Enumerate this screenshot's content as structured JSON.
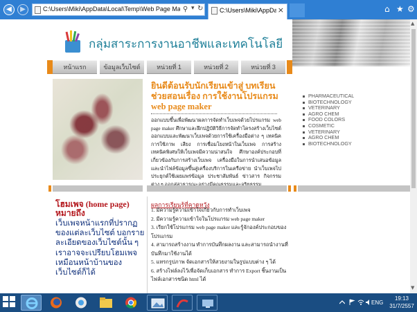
{
  "browser": {
    "address": "C:\\Users\\Miki\\AppData\\Local\\Temp\\Web Page Maker\\Preview\\sen",
    "tab_title": "C:\\Users\\Miki\\AppData\\Lo...",
    "tab_close": "×",
    "icons": [
      "back-icon",
      "forward-icon",
      "search-icon",
      "refresh-icon",
      "home-icon",
      "favorites-icon",
      "tools-icon"
    ]
  },
  "site": {
    "title": "กลุ่มสาระการงานอาชีพและเทคโนโลยี",
    "accent_color": "#e88a1a",
    "title_color": "#1e7f98"
  },
  "nav": {
    "items": [
      "หน้าแรก",
      "ข้อมูลเว็บไซต์",
      "หน่วยที่ 1",
      "หน่วยที่ 2",
      "หน่วยที่ 3"
    ]
  },
  "hero": {
    "heading": "ยินดีต้อนรับนักเรียนเข้าสู่  บทเรียนช่วยสอนเรื่อง  การใช้งานโปรแกรม web page maker",
    "body": "ออกแบบขึ้นเพื่อพัฒนาผลการจัดทำเว็บเพจด้วยโปรแกรม web page maker ศึกษาและฝึกปฏิบัติวิธีการจัดทำโครงสร้างเว็บไซต์ ออกแบบและพัฒนาเว็บเพจด้วยการใช้เครื่องมือต่าง ๆ เทคนิคการใช้ภาพ เสียง การเชื่อมโยงหน้าในเว็บเพจ การสร้างเทคนิคพิเศษให้เว็บเพจมีความน่าสนใจ ศึกษาองค์ประกอบที่เกี่ยวข้องกับการสร้างเว็บเพจ เครื่องมือในการนำเสนอข้อมูล และนำไฟล์ข้อมูลขึ้นสู่เครื่องบริการในเครือข่าย นำเว็บเพจไปประยุกต์ใช้เผยแพร่ข้อมูล ประชาสัมพันธ์ ข่าวสาร กิจกรรมต่าง ๆ ออกสู่สาธารณะอย่างมีคุณธรรมและจริยธรรม"
  },
  "categories": [
    "PHARMACEUTICAL",
    "BIOTECHNOLOGY",
    "VETERINARY",
    "AGRO CHEM",
    "FOOD COLORS",
    "COSMETIC",
    "VETERINARY",
    "AGRO CHEM",
    "BIOTECHNOLOGY"
  ],
  "home": {
    "title": "โฮมเพจ (home page) หมายถึง",
    "body": "เว็บเพจหน้าแรกที่ปรากฏของแต่ละเว็บไซต์ บอกรายละเอียดของเว็บไซต์นั้น ๆ เราอาจจะเปรียบโฮมเพจเหมือนหน้าบ้านของเว็บไซต์ก็ได้"
  },
  "objectives": {
    "heading": "ผลการเรียนรู้ที่คาดหวัง",
    "items": [
      "1. มีความรู้ความเข้าใจเกี่ยวกับการทำเว็บเพจ",
      "2. มีความรู้ความเข้าใจในโปรแกรม web page maker",
      "3. เรียกใช้โปรแกรม web page maker และรู้จักองค์ประกอบของโปรแกรม",
      "4. สามารถสร้างงาน ทำการบันทึกผลงาน และสามารถนำงานที่บันทึกมาใช้งานได้",
      "5. แทรกรูปภาพ จัดเอกสารให้สวยงามในรูปแบบต่าง ๆ ได้",
      "6. สร้างไฟล์ลงไว้เพื่อจัดเก็บเอกสาร ทำการ Export ชิ้นงานเป็นไฟล์เอกสารชนิด html ได้"
    ]
  },
  "taskbar": {
    "lang": "ENG",
    "time": "19:13",
    "date": "31/7/2557"
  }
}
